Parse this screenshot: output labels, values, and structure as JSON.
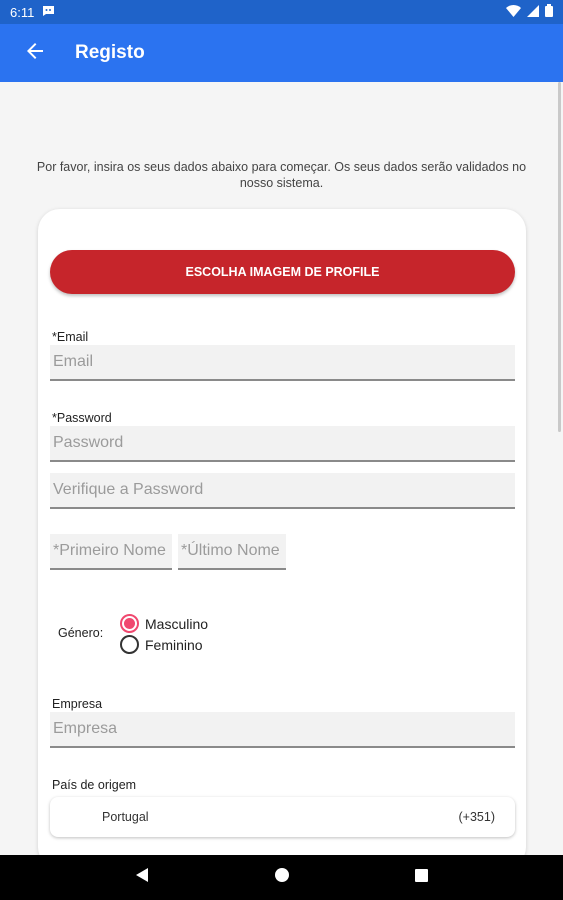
{
  "status_bar": {
    "time": "6:11"
  },
  "app_bar": {
    "title": "Registo"
  },
  "intro_text": "Por favor, insira os seus dados abaixo para começar. Os seus dados serão validados no nosso sistema.",
  "form": {
    "profile_button": "ESCOLHA IMAGEM DE PROFILE",
    "email_label": "*Email",
    "email_placeholder": "Email",
    "password_label": "*Password",
    "password_placeholder": "Password",
    "verify_password_placeholder": "Verifique a Password",
    "first_name_placeholder": "*Primeiro Nome",
    "last_name_placeholder": "*Último Nome",
    "gender_label": "Género:",
    "gender_options": [
      {
        "label": "Masculino",
        "selected": true
      },
      {
        "label": "Feminino",
        "selected": false
      }
    ],
    "company_label": "Empresa",
    "company_placeholder": "Empresa",
    "country_label": "País de origem",
    "country_value": "Portugal",
    "country_code": "(+351)"
  },
  "colors": {
    "app_bar": "#2b73f0",
    "status_bar": "#1f63c9",
    "primary_button": "#c6252b",
    "radio_accent": "#f0486f"
  },
  "icons": {
    "back": "arrow-left-icon",
    "wifi": "wifi-icon",
    "signal": "signal-icon",
    "battery": "battery-icon",
    "message": "message-icon",
    "nav_back": "triangle-back-icon",
    "nav_home": "circle-home-icon",
    "nav_recents": "square-recents-icon"
  }
}
